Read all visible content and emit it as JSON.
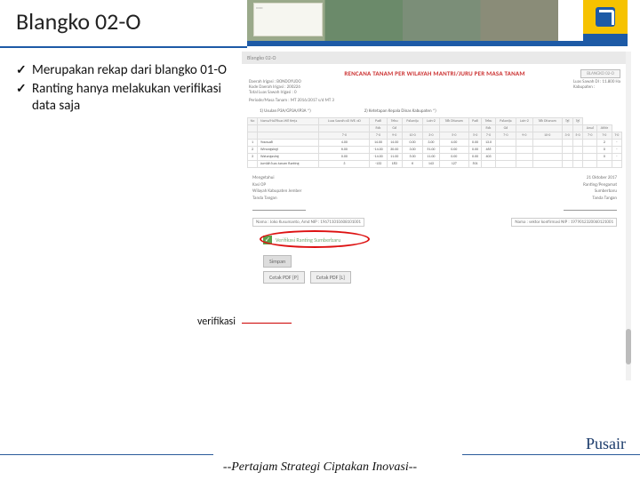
{
  "title": "Blangko 02-O",
  "bullets": [
    "Merupakan rekap dari blangko 01-O",
    "Ranting hanya melakukan verifikasi data saja"
  ],
  "callout": "verifikasi",
  "footer": {
    "brand": "Pusair",
    "motto": "--Pertajam Strategi Ciptakan Inovasi--"
  },
  "screenshot": {
    "breadcrumb": "Blangko 02-O",
    "doc_title": "RENCANA TANAM PER WILAYAH MANTRI/JURU PER MASA TANAM",
    "blangko_tag": "BLANGKO 02-O",
    "meta_left": [
      "Daerah Irigasi : BONDOYUDO",
      "Kode Daerah Irigasi : 200226",
      "Total Luas Sawah Irigasi : 0"
    ],
    "meta_right": [
      "Luas Sawah DI : 11.800 Ha",
      "Kabupaten :"
    ],
    "periode": "Periode/Masa Tanam : MT 2016/2017 s/d MT 3",
    "section_headers": [
      "1) Usulan P3A/GP3A/IP3A *)",
      "2) Ketetapan Kepala Dinas Kabupaten *)"
    ],
    "table": {
      "top": [
        "No",
        "Nama/Hal/Ruas Wil Kerja",
        "Luas Sawah oD Wil. oD",
        "Padi",
        "Tebu",
        "Palawija",
        "Lain-2",
        "Tdk Ditanam",
        "Padi",
        "Tebu",
        "Palawija",
        "Lain-2",
        "Tdk Ditanam",
        "Tgl",
        "Tgl"
      ],
      "sub": [
        "",
        "",
        "",
        "Rdc",
        "Gd",
        "",
        "",
        "",
        "",
        "Rdc",
        "Gd",
        "",
        "",
        "",
        "",
        "Awal",
        "Akhir"
      ],
      "idx": [
        "",
        "",
        "7-0",
        "7-0",
        "9-0",
        "10-0",
        "3-0",
        "5-0",
        "5-0",
        "7-0",
        "7-0",
        "9-0",
        "10-0",
        "3-0",
        "5-0",
        "7-0",
        "T-0",
        "T-0"
      ],
      "rows": [
        [
          "1",
          "Yososadi",
          "4.00",
          "14.00",
          "14.00",
          "0.00",
          "3.00",
          "4.00",
          "0.00",
          "13.0",
          "",
          "",
          "",
          "",
          "",
          "",
          "2",
          "-"
        ],
        [
          "2",
          "Winongsingi",
          "6.00",
          "-14.00",
          "30.00",
          "3.00",
          "51.00",
          "0.00",
          "0.00",
          "465",
          "",
          "",
          "",
          "",
          "",
          "",
          "0",
          "-"
        ],
        [
          "3",
          "Watangasing",
          "0.00",
          "-14.00",
          "11.00",
          "5.00",
          "11.00",
          "0.00",
          "0.00",
          "403",
          "",
          "",
          "",
          "",
          "",
          "",
          "0",
          "-"
        ],
        [
          "",
          "Jumlah luas tanam Ranting",
          "3",
          "-132",
          "183",
          "6",
          "143",
          "127",
          "501",
          "",
          "",
          "",
          "",
          "",
          "",
          "",
          "",
          ""
        ]
      ]
    },
    "sign": {
      "date": "21 Oktober 2017",
      "left": [
        "Mengetahui",
        "Kasi OP",
        "Wilayah Kabupaten Jember",
        "Tanda Tangan"
      ],
      "right": [
        "Ranting/Pengamat",
        "Sumberbaru",
        "Tanda Tangan"
      ]
    },
    "names": {
      "left": "Nama : Joko Kusumanto, Amd\\nNIP : 196711010608101001",
      "right": "Nama : sektor konfirmasi\\nNIP : 1979012320060121001"
    },
    "verif": {
      "checked": true,
      "label": "Verifikasi Ranting Sumberbaru"
    },
    "buttons": {
      "save": "Simpan",
      "pdfp": "Cetak PDF [P]",
      "pdfl": "Cetak PDF [L]"
    }
  }
}
